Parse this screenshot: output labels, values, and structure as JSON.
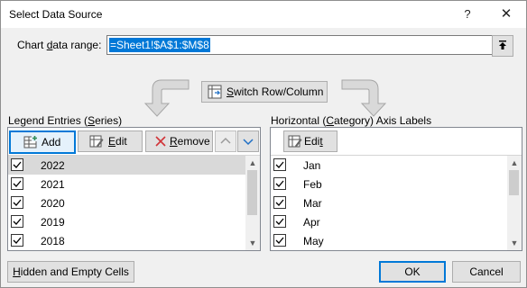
{
  "window": {
    "title": "Select Data Source",
    "help_glyph": "?",
    "close_glyph": "✕"
  },
  "range": {
    "label": "Chart data range:",
    "value": "=Sheet1!$A$1:$M$8"
  },
  "switch_label": "Switch Row/Column",
  "legend": {
    "label": "Legend Entries (Series)",
    "add": "Add",
    "edit": "Edit",
    "remove": "Remove",
    "items": [
      {
        "label": "2022",
        "checked": true,
        "selected": true
      },
      {
        "label": "2021",
        "checked": true
      },
      {
        "label": "2020",
        "checked": true
      },
      {
        "label": "2019",
        "checked": true
      },
      {
        "label": "2018",
        "checked": true
      }
    ]
  },
  "axis": {
    "label": "Horizontal (Category) Axis Labels",
    "edit": "Edit",
    "items": [
      {
        "label": "Jan",
        "checked": true
      },
      {
        "label": "Feb",
        "checked": true
      },
      {
        "label": "Mar",
        "checked": true
      },
      {
        "label": "Apr",
        "checked": true
      },
      {
        "label": "May",
        "checked": true
      }
    ]
  },
  "buttons": {
    "hidden_empty": "Hidden and Empty Cells",
    "ok": "OK",
    "cancel": "Cancel"
  },
  "colors": {
    "accent": "#0078d7",
    "remove_x": "#d13438",
    "green": "#2e8b57"
  }
}
